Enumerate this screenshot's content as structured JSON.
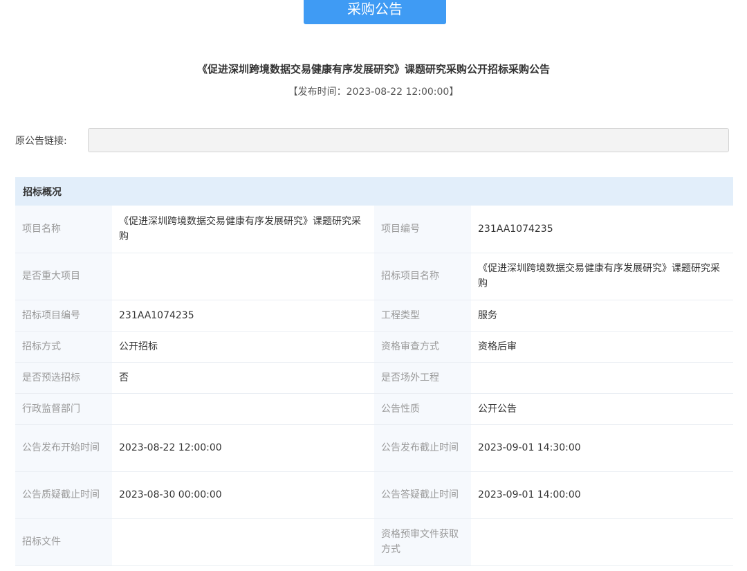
{
  "header": {
    "tab_label": "采购公告"
  },
  "notice": {
    "title": "《促进深圳跨境数据交易健康有序发展研究》课题研究采购公开招标采购公告",
    "publish_time": "【发布时间：2023-08-22 12:00:00】"
  },
  "original_link": {
    "label": "原公告链接:",
    "value": ""
  },
  "overview": {
    "section_title": "招标概况",
    "rows": [
      {
        "l1": "项目名称",
        "v1": "《促进深圳跨境数据交易健康有序发展研究》课题研究采购",
        "l2": "项目编号",
        "v2": "231AA1074235"
      },
      {
        "l1": "是否重大项目",
        "v1": "",
        "l2": "招标项目名称",
        "v2": "《促进深圳跨境数据交易健康有序发展研究》课题研究采购"
      },
      {
        "l1": "招标项目编号",
        "v1": "231AA1074235",
        "l2": "工程类型",
        "v2": "服务"
      },
      {
        "l1": "招标方式",
        "v1": "公开招标",
        "l2": "资格审查方式",
        "v2": "资格后审"
      },
      {
        "l1": "是否预选招标",
        "v1": "否",
        "l2": "是否场外工程",
        "v2": ""
      },
      {
        "l1": "行政监督部门",
        "v1": "",
        "l2": "公告性质",
        "v2": "公开公告"
      },
      {
        "l1": "公告发布开始时间",
        "v1": "2023-08-22 12:00:00",
        "l2": "公告发布截止时间",
        "v2": "2023-09-01 14:30:00"
      },
      {
        "l1": "公告质疑截止时间",
        "v1": "2023-08-30 00:00:00",
        "l2": "公告答疑截止时间",
        "v2": "2023-09-01 14:00:00"
      },
      {
        "l1": "招标文件",
        "v1": "",
        "l2": "资格预审文件获取方式",
        "v2": ""
      }
    ]
  }
}
